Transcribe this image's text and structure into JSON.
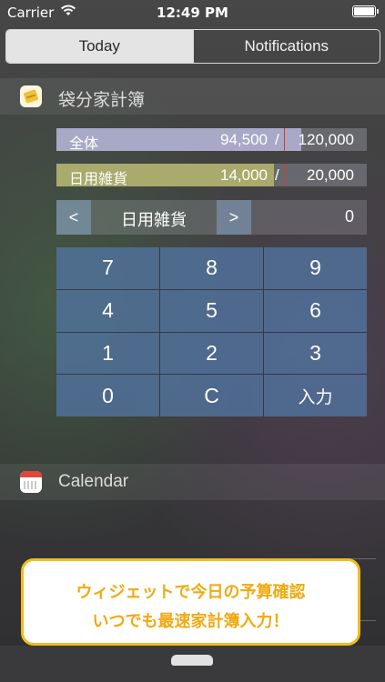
{
  "status_bar": {
    "carrier": "Carrier",
    "time": "12:49 PM",
    "battery_level": 1.0
  },
  "tabs": [
    {
      "label": "Today",
      "active": true
    },
    {
      "label": "Notifications",
      "active": false
    }
  ],
  "widget": {
    "title": "袋分家計簿",
    "icon": "money-pouch-icon",
    "budgets": [
      {
        "label": "全体",
        "used": "94,500",
        "separator": "/",
        "limit": "120,000",
        "fill_fraction": 0.79,
        "fill_color": "#a8a9c6"
      },
      {
        "label": "日用雑貨",
        "used": "14,000",
        "separator": "/",
        "limit": "20,000",
        "fill_fraction": 0.7,
        "fill_color": "#a8ab6c"
      }
    ],
    "selector": {
      "prev_label": "<",
      "category": "日用雑貨",
      "next_label": ">",
      "amount": "0"
    },
    "keypad": [
      "7",
      "8",
      "9",
      "4",
      "5",
      "6",
      "1",
      "2",
      "3",
      "0",
      "C",
      "入力"
    ]
  },
  "calendar": {
    "title": "Calendar",
    "icon": "calendar-icon"
  },
  "callout": {
    "line1": "ウィジェットで今日の予算確認",
    "line2": "いつでも最速家計簿入力！",
    "border_color": "#f2bb1d",
    "text_color": "#f0aa12"
  }
}
